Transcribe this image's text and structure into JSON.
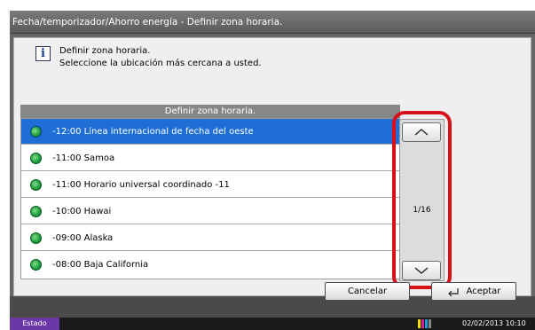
{
  "window": {
    "title": "Fecha/temporizador/Ahorro energía - Definir zona horaria."
  },
  "message": {
    "icon": "info-icon",
    "line1": "Definir zona horaria.",
    "line2": "Seleccione la ubicación más cercana a usted."
  },
  "list": {
    "header": "Definir zona horaria.",
    "items": [
      {
        "label": "-12:00 Línea internacional de fecha del oeste",
        "selected": true,
        "icon": "globe-icon"
      },
      {
        "label": "-11:00 Samoa",
        "selected": false,
        "icon": "globe-icon"
      },
      {
        "label": "-11:00 Horario universal coordinado -11",
        "selected": false,
        "icon": "globe-icon"
      },
      {
        "label": "-10:00 Hawai",
        "selected": false,
        "icon": "globe-icon"
      },
      {
        "label": "-09:00 Alaska",
        "selected": false,
        "icon": "globe-icon"
      },
      {
        "label": "-08:00 Baja California",
        "selected": false,
        "icon": "globe-icon"
      }
    ]
  },
  "scroll": {
    "page_indicator": "1/16",
    "up_icon": "chevron-up-icon",
    "down_icon": "chevron-down-icon"
  },
  "buttons": {
    "cancel": "Cancelar",
    "accept": "Aceptar",
    "accept_icon": "enter-arrow-icon"
  },
  "status": {
    "label": "Estado",
    "datetime": "02/02/2013  10:10"
  },
  "colors": {
    "selected_row": "#1f6ed6",
    "highlight": "#d8101a",
    "status_label": "#6b36a6"
  }
}
